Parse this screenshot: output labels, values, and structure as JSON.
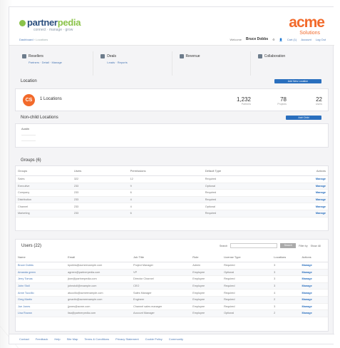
{
  "header": {
    "logo_main": "partner",
    "logo_accent": "pedia",
    "logo_tagline": "connect · manage · grow",
    "breadcrumb_root": "Dashboard",
    "breadcrumb_sep": " › ",
    "breadcrumb_current": "Locations",
    "brand_name": "acme",
    "brand_sub": "Solutions",
    "welcome": "Welcome",
    "user_name": "Bruce Dobbs",
    "cart": "Cart (1)",
    "account": "Account",
    "logout": "Log Out"
  },
  "nav": [
    {
      "label": "Resellers",
      "links": "Partners · Detail · Manage"
    },
    {
      "label": "Deals",
      "links": "Leads · Reports"
    },
    {
      "label": "Revenue",
      "links": ""
    },
    {
      "label": "Collaboration",
      "links": ""
    }
  ],
  "location": {
    "section_title": "Location",
    "action_button": "Add New Location",
    "badge": "CS",
    "name": "1 Locations",
    "stats": [
      {
        "value": "1,232",
        "label": "Partners"
      },
      {
        "value": "78",
        "label": "Projects"
      },
      {
        "value": "22",
        "label": "Users"
      }
    ]
  },
  "child": {
    "section_title": "Non-child Locations",
    "button": "Add Child",
    "lines": [
      "Austin",
      "—————",
      "—————"
    ]
  },
  "groups": {
    "section_title": "Groups (6)",
    "columns": [
      "Groups",
      "Users",
      "Permissions",
      "Default Type",
      "Actions"
    ],
    "rows": [
      [
        "Sales",
        "322",
        "12",
        "Required",
        "Manage"
      ],
      [
        "Executive",
        "233",
        "9",
        "Optional",
        "Manage"
      ],
      [
        "Company",
        "233",
        "6",
        "Required",
        "Manage"
      ],
      [
        "Distribution",
        "233",
        "4",
        "Required",
        "Manage"
      ],
      [
        "Channel",
        "233",
        "4",
        "Optional",
        "Manage"
      ],
      [
        "Marketing",
        "233",
        "6",
        "Required",
        "Manage"
      ]
    ]
  },
  "users": {
    "section_title": "Users (22)",
    "search_label": "Search",
    "search_button": "Search",
    "filter_label": "Filter by",
    "filter_value": "Show: All",
    "columns": [
      "Name",
      "Email",
      "Job Title",
      "Role",
      "License Type",
      "Locations",
      "Actions"
    ],
    "rows": [
      [
        "Bruce Dobbs",
        "bpobbs@acmeexample.com",
        "Project Manager",
        "Admin",
        "Required",
        "3",
        "Manage"
      ],
      [
        "Amanda green",
        "agreen@partnerpedia.com",
        "VP",
        "Employee",
        "Optional",
        "3",
        "Manage"
      ],
      [
        "Jerry Tomas",
        "jtom@partnerpedia.com",
        "Director Channel",
        "Employee",
        "Required",
        "3",
        "Manage"
      ],
      [
        "John Stoll",
        "johnstoll@example.com",
        "CEO",
        "Employee",
        "Required",
        "3",
        "Manage"
      ],
      [
        "Anne Tuccillo",
        "atuccillo@acmeexample.com",
        "Sales Manager",
        "Employee",
        "Required",
        "4",
        "Manage"
      ],
      [
        "Greg Martin",
        "gmartin@acmeexample.com",
        "Engineer",
        "Employee",
        "Required",
        "2",
        "Manage"
      ],
      [
        "Joe Jones",
        "jjones@acme.com",
        "Channel sales manager",
        "Employee",
        "Required",
        "3",
        "Manage"
      ],
      [
        "Lisa Rowan",
        "lisa@partnerpedia.com",
        "Account Manager",
        "Employee",
        "Optional",
        "2",
        "Manage"
      ]
    ]
  },
  "footer": {
    "links": [
      "Contact",
      "Feedback",
      "Help",
      "Site Map",
      "Terms & Conditions",
      "Privacy Statement",
      "Cookie Policy",
      "Community"
    ]
  },
  "colors": {
    "accent": "#f26a2b",
    "primary": "#2a6fbe",
    "logo": "#8bc34a"
  }
}
